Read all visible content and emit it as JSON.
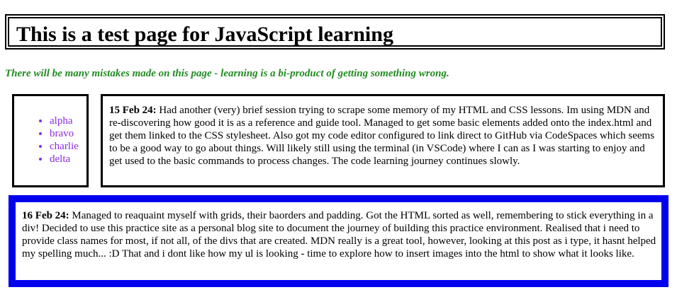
{
  "header": {
    "title": "This is a test page for JavaScript learning"
  },
  "subtitle": "There will be many mistakes made on this page - learning is a bi-product of getting something wrong.",
  "sidebar": {
    "items": [
      "alpha",
      "bravo",
      "charlie",
      "delta"
    ]
  },
  "posts": [
    {
      "date": "15 Feb 24:",
      "body": "Had another (very) brief session trying to scrape some memory of my HTML and CSS lessons. Im using MDN and re-discovering how good it is as a reference and guide tool. Managed to get some basic elements added onto the index.html and get them linked to the CSS stylesheet. Also got my code editor configured to link direct to GitHub via CodeSpaces which seems to be a good way to go about things. Will likely still using the terminal (in VSCode) where I can as I was starting to enjoy and get used to the basic commands to process changes. The code learning journey continues slowly."
    },
    {
      "date": "16 Feb 24:",
      "body": "Managed to reaquaint myself with grids, their baorders and padding. Got the HTML sorted as well, remembering to stick everything in a div! Decided to use this practice site as a personal blog site to document the journey of building this practice environment. Realised that i need to provide class names for most, if not all, of the divs that are created. MDN really is a great tool, however, looking at this post as i type, it hasnt helped my spelling much... :D That and i dont like how my ul is looking - time to explore how to insert images into the html to show what it looks like."
    }
  ],
  "colors": {
    "subtitle": "#228b22",
    "list_items": "#8a2be2",
    "post2_border": "#0000ee",
    "default_border": "#000000"
  }
}
